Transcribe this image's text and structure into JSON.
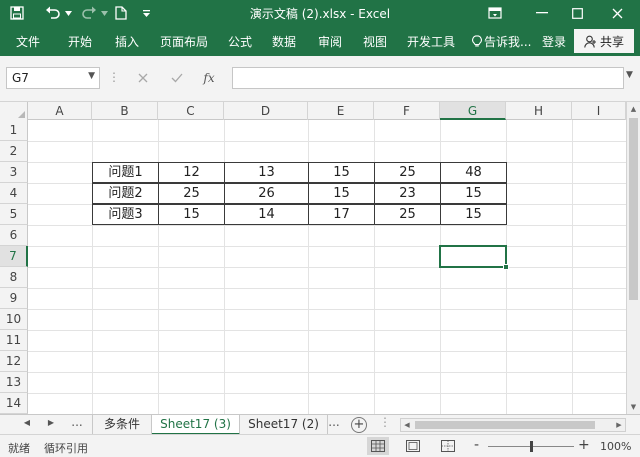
{
  "title_bar": {
    "document_title": "演示文稿 (2).xlsx - Excel",
    "save_icon": "save-icon",
    "undo_icon": "undo-icon",
    "redo_icon": "redo-icon",
    "new_icon": "new-file-icon",
    "customize_icon": "customize-qat-icon"
  },
  "ribbon": {
    "tabs": [
      "文件",
      "开始",
      "插入",
      "页面布局",
      "公式",
      "数据",
      "审阅",
      "视图",
      "开发工具"
    ],
    "tell_me": "告诉我...",
    "login": "登录",
    "share": "共享"
  },
  "formula_bar": {
    "name_box": "G7",
    "fx_label": "fx",
    "formula_value": ""
  },
  "sheet": {
    "columns": [
      "A",
      "B",
      "C",
      "D",
      "E",
      "F",
      "G",
      "H",
      "I"
    ],
    "rows": [
      "1",
      "2",
      "3",
      "4",
      "5",
      "6",
      "7",
      "8",
      "9",
      "10",
      "11",
      "12",
      "13",
      "14"
    ],
    "selected_column": "G",
    "selected_row": "7",
    "table": [
      [
        "问题1",
        "12",
        "13",
        "15",
        "25",
        "48"
      ],
      [
        "问题2",
        "25",
        "26",
        "15",
        "23",
        "15"
      ],
      [
        "问题3",
        "15",
        "14",
        "17",
        "25",
        "15"
      ]
    ]
  },
  "sheet_tabs": {
    "ellipsis_left": "...",
    "tabs": [
      "多条件",
      "Sheet17 (3)",
      "Sheet17 (2)"
    ],
    "active_tab": "Sheet17 (3)",
    "ellipsis_right": "..."
  },
  "status_bar": {
    "mode": "就绪",
    "circular_ref": "循环引用",
    "zoom_minus": "-",
    "zoom_plus": "+",
    "zoom": "100%"
  },
  "colors": {
    "excel_green": "#217346",
    "grid_line": "#e3e3e3",
    "header_bg": "#f3f3f3"
  }
}
